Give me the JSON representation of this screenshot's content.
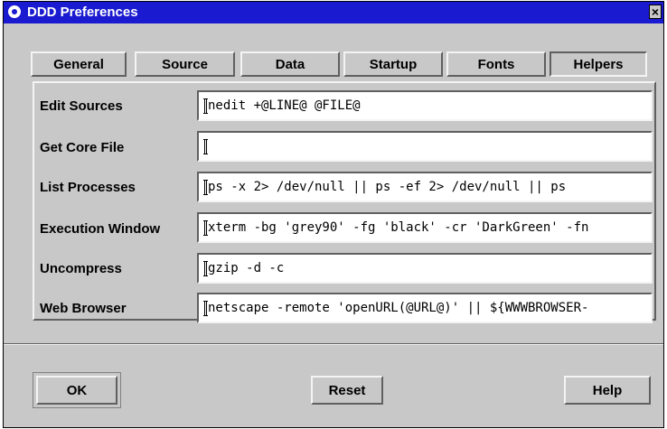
{
  "window": {
    "title": "DDD Preferences",
    "close_glyph": "×"
  },
  "tabs": [
    {
      "label": "General",
      "active": false
    },
    {
      "label": "Source",
      "active": false
    },
    {
      "label": "Data",
      "active": false
    },
    {
      "label": "Startup",
      "active": false
    },
    {
      "label": "Fonts",
      "active": false
    },
    {
      "label": "Helpers",
      "active": true
    }
  ],
  "helpers": [
    {
      "label": "Edit Sources",
      "value": "nedit +@LINE@ @FILE@"
    },
    {
      "label": "Get Core File",
      "value": ""
    },
    {
      "label": "List Processes",
      "value": "ps -x 2> /dev/null || ps -ef 2> /dev/null || ps"
    },
    {
      "label": "Execution Window",
      "value": "xterm -bg 'grey90' -fg 'black' -cr 'DarkGreen' -fn"
    },
    {
      "label": "Uncompress",
      "value": "gzip -d -c"
    },
    {
      "label": "Web Browser",
      "value": "netscape -remote 'openURL(@URL@)' || ${WWWBROWSER-"
    }
  ],
  "buttons": {
    "ok": "OK",
    "reset": "Reset",
    "help": "Help"
  },
  "colors": {
    "titlebar": "#1a1ad0",
    "window_bg": "#c8c8c8",
    "field_bg": "#ffffff"
  },
  "icons": {
    "window_menu": "window-menu-icon",
    "close": "close-icon"
  }
}
